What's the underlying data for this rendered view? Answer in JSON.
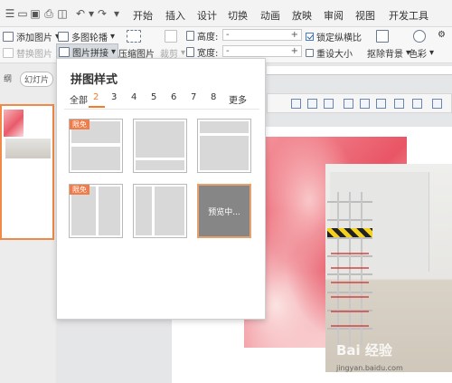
{
  "quick_access": {
    "icons": [
      "menu-icon",
      "folder-icon",
      "save-icon",
      "print-icon",
      "preview-icon",
      "undo-icon",
      "redo-icon",
      "dropdown-icon"
    ]
  },
  "menu": {
    "items": [
      "开始",
      "插入",
      "设计",
      "切换",
      "动画",
      "放映",
      "审阅",
      "视图",
      "开发工具"
    ]
  },
  "ribbon": {
    "add_picture": "添加图片",
    "replace_picture": "替换图片",
    "multi_outline": "多图轮播",
    "picture_collage": "图片拼接",
    "compress": "压缩图片",
    "crop": "裁剪",
    "height_label": "高度:",
    "width_label": "宽度:",
    "height_value": "-",
    "width_value": "-",
    "lock_ratio": "锁定纵横比",
    "reset_size": "重设大小",
    "remove_bg": "抠除背景",
    "color": "色彩"
  },
  "left_pane": {
    "tab_outline": "纲",
    "tab_slides": "幻灯片"
  },
  "dropdown": {
    "title": "拼图样式",
    "tabs": [
      "全部",
      "2",
      "3",
      "4",
      "5",
      "6",
      "7",
      "8",
      "更多"
    ],
    "active_tab": "2",
    "badge": "限免",
    "preview_text": "预览中..."
  },
  "watermark": {
    "brand": "Bai 经验",
    "url": "jingyan.baidu.com"
  }
}
